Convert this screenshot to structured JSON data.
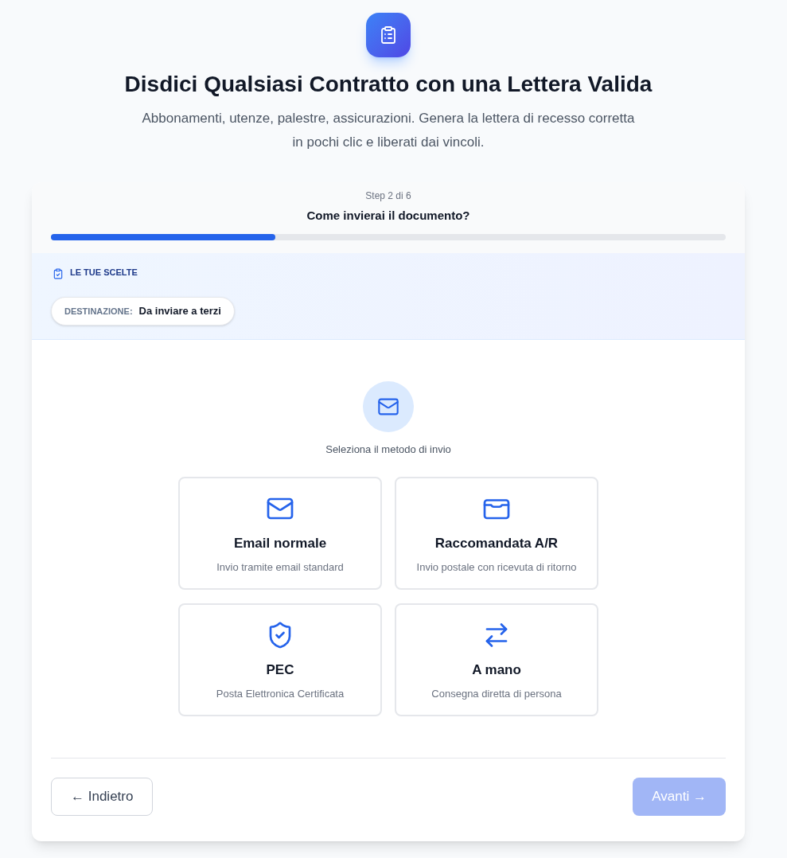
{
  "header": {
    "title": "Disdici Qualsiasi Contratto con una Lettera Valida",
    "subtitle": "Abbonamenti, utenze, palestre, assicurazioni. Genera la lettera di recesso corretta in pochi clic e liberati dai vincoli."
  },
  "wizard": {
    "step": "Step 2 di 6",
    "question": "Come invierai il documento?",
    "progress": {
      "level": 0.333
    }
  },
  "choices": {
    "title": "LE TUE SCELTE",
    "items": [
      {
        "label": "DESTINAZIONE:",
        "value": "Da inviare a terzi"
      }
    ]
  },
  "method_prompt": "Seleziona il metodo di invio",
  "methods": [
    {
      "kind": "email",
      "title": "Email normale",
      "description": "Invio tramite email standard",
      "selected": false
    },
    {
      "kind": "registered",
      "title": "Raccomandata A/R",
      "description": "Invio postale con ricevuta di ritorno",
      "selected": false
    },
    {
      "kind": "pec",
      "title": "PEC",
      "description": "Posta Elettronica Certificata",
      "selected": false
    },
    {
      "kind": "hand",
      "title": "A mano",
      "description": "Consegna diretta di persona",
      "selected": false
    }
  ],
  "nav": {
    "back": {
      "label": "← Indietro",
      "disabled": false
    },
    "next": {
      "label": "Avanti →",
      "disabled": true
    }
  }
}
